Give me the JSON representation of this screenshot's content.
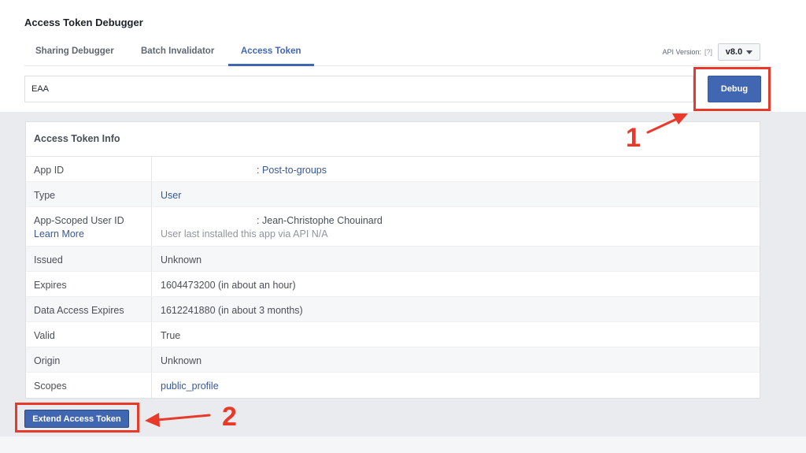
{
  "page_title": "Access Token Debugger",
  "tabs": [
    {
      "label": "Sharing Debugger",
      "active": false
    },
    {
      "label": "Batch Invalidator",
      "active": false
    },
    {
      "label": "Access Token",
      "active": true
    }
  ],
  "api_version": {
    "label": "API Version:",
    "help": "[?]",
    "value": "v8.0"
  },
  "token_input": {
    "value": "EAA"
  },
  "debug_button": "Debug",
  "panel": {
    "title": "Access Token Info",
    "rows": [
      {
        "label": "App ID",
        "value_prefix": ":",
        "value": "Post-to-groups"
      },
      {
        "label": "Type",
        "value": "User"
      },
      {
        "label": "App-Scoped User ID",
        "link": "Learn More",
        "value_prefix": ":",
        "value": "Jean-Christophe Chouinard",
        "subvalue": "User last installed this app via API N/A"
      },
      {
        "label": "Issued",
        "value": "Unknown"
      },
      {
        "label": "Expires",
        "value": "1604473200 (in about an hour)"
      },
      {
        "label": "Data Access Expires",
        "value": "1612241880 (in about 3 months)"
      },
      {
        "label": "Valid",
        "value": "True"
      },
      {
        "label": "Origin",
        "value": "Unknown"
      },
      {
        "label": "Scopes",
        "value": "public_profile"
      }
    ]
  },
  "extend_button": "Extend Access Token",
  "annotations": {
    "step1": "1",
    "step2": "2",
    "color": "#e83a2a"
  },
  "colors": {
    "accent": "#4267b2",
    "link": "#365899",
    "background": "#e9ebee"
  }
}
